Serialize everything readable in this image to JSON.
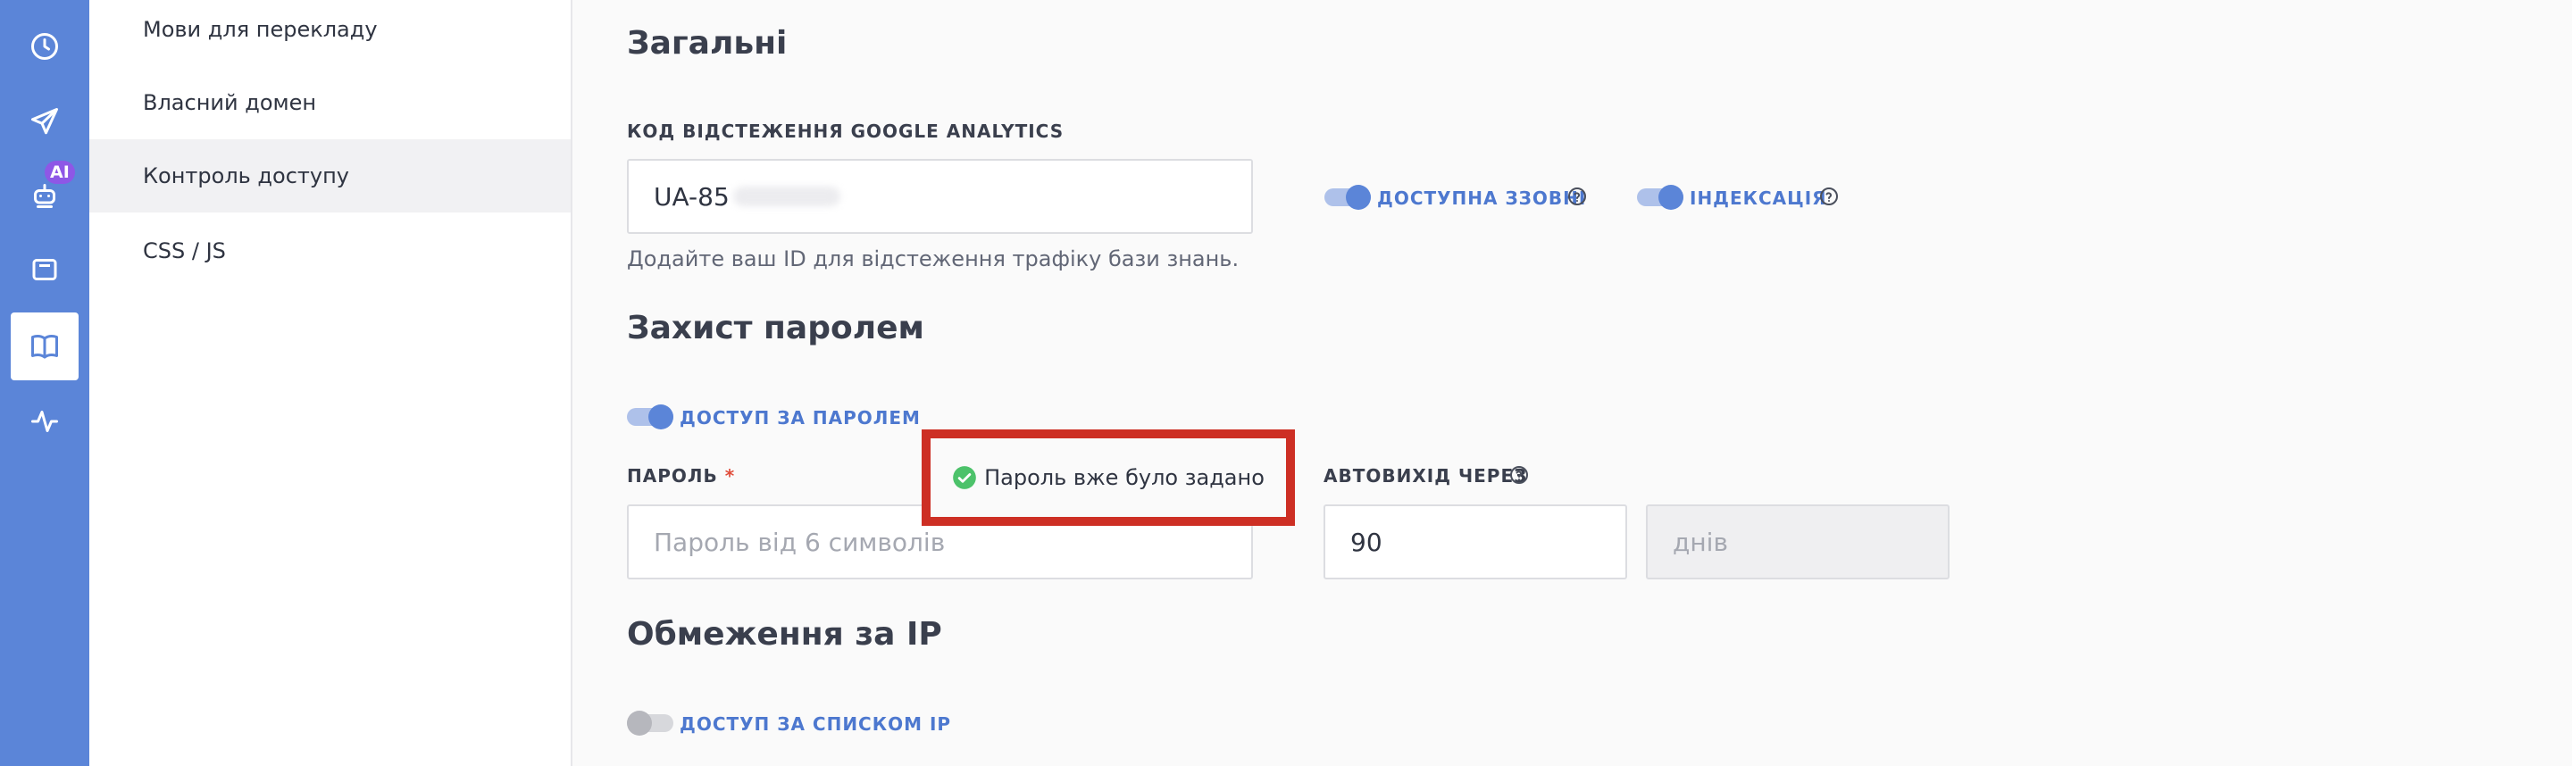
{
  "rail": {
    "items": [
      {
        "icon": "clock-icon"
      },
      {
        "icon": "paper-plane-icon"
      },
      {
        "icon": "ai-bot-icon",
        "badge": "AI"
      },
      {
        "icon": "wallet-icon"
      },
      {
        "icon": "book-icon",
        "active": true
      },
      {
        "icon": "activity-icon"
      }
    ],
    "color": "#5b85d8",
    "badge_color": "#8e57e6"
  },
  "sidebar": {
    "items": [
      {
        "label": "Мови для перекладу"
      },
      {
        "label": "Власний домен"
      },
      {
        "label": "Контроль доступу",
        "active": true
      },
      {
        "label": "CSS / JS"
      }
    ]
  },
  "general": {
    "title": "Загальні",
    "ga_label": "Код відстеження Google Analytics",
    "ga_value": "UA-85",
    "ga_hint": "Додайте ваш ID для відстеження трафіку бази знань.",
    "toggles": {
      "external": {
        "label": "Доступна ззовні",
        "on": true
      },
      "indexing": {
        "label": "Індексація",
        "on": true
      }
    }
  },
  "password": {
    "title": "Захист паролем",
    "toggle_label": "Доступ за паролем",
    "toggle_on": true,
    "field_label": "Пароль",
    "required_mark": "*",
    "placeholder": "Пароль від 6 символів",
    "status": "Пароль вже було задано",
    "logout_label": "Автовихід через",
    "logout_value": "90",
    "logout_unit": "днів"
  },
  "ip": {
    "title": "Обмеження за IP",
    "toggle_label": "Доступ за списком IP",
    "toggle_on": false
  },
  "colors": {
    "accent": "#5b85d8",
    "callout_border": "#cd2f24",
    "success": "#4cc26a"
  }
}
